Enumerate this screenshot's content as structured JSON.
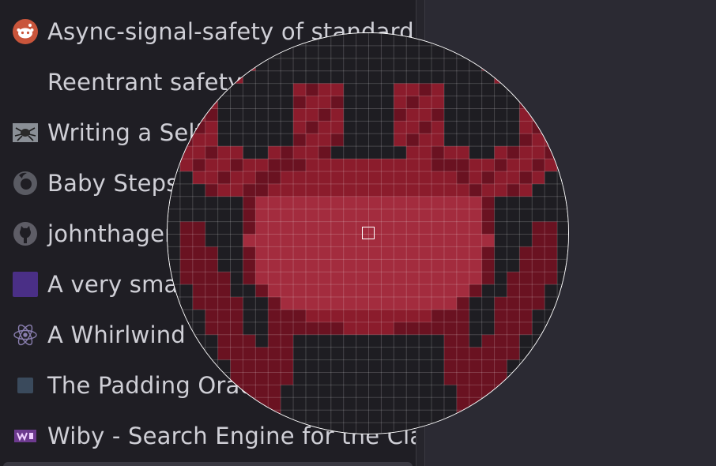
{
  "bookmarks": [
    {
      "label": "Async-signal-safety of standard l",
      "icon": "reddit-icon"
    },
    {
      "label": "Reentrant safety",
      "icon": "blank-icon"
    },
    {
      "label": "Writing a Self",
      "icon": "spider-thumbnail-icon"
    },
    {
      "label": "Baby Steps",
      "icon": "firefox-icon"
    },
    {
      "label": "johnthagen",
      "icon": "github-icon"
    },
    {
      "label": "A very smal",
      "icon": "purple-square-icon"
    },
    {
      "label": "A Whirlwind T",
      "icon": "atom-icon"
    },
    {
      "label": "The Padding Orac",
      "icon": "slate-square-icon"
    },
    {
      "label": "Wiby - Search Engine for the Clas",
      "icon": "wiby-icon"
    }
  ],
  "magnifier": {
    "subject": "ferris-crab-pixels",
    "colors": {
      "dark": "#1e1d22",
      "body": "#8b1c2c",
      "light": "#a32c3e",
      "shadow": "#6a1221",
      "grid": "#ffffff"
    }
  },
  "colors": {
    "sidebar_bg": "#1f1e24",
    "pane_bg": "#2b2a33",
    "text": "#cfcfd6"
  }
}
